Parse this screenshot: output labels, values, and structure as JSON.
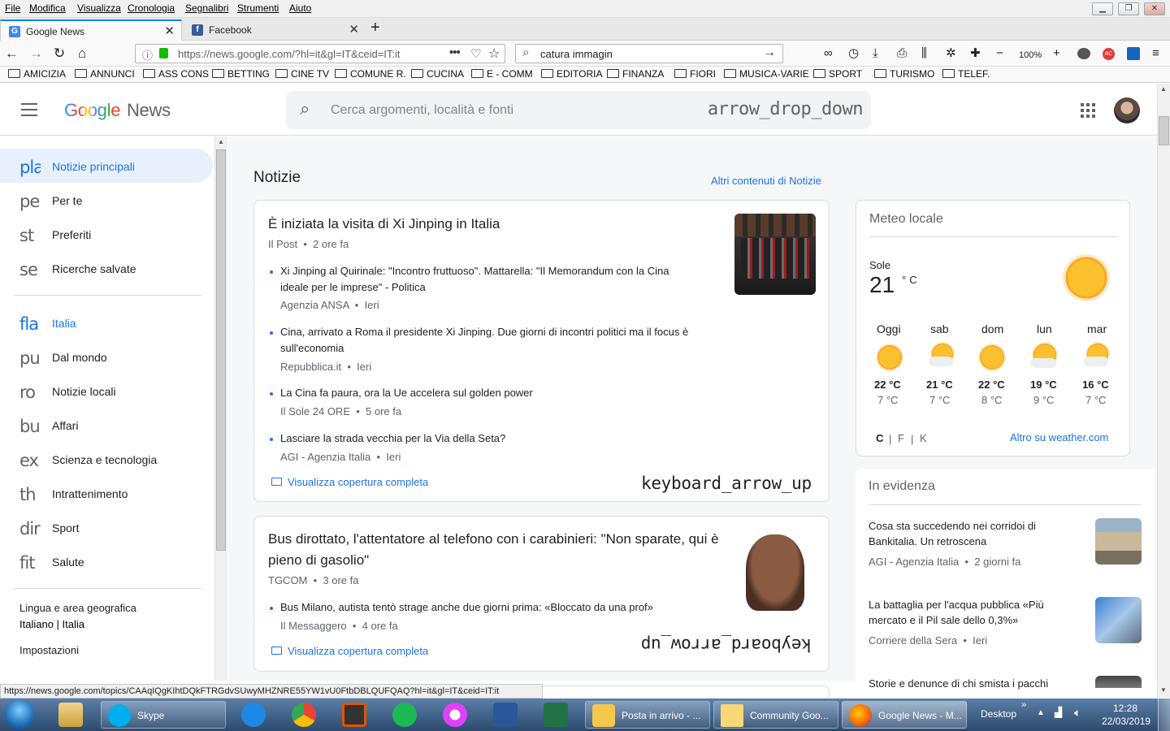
{
  "menubar": {
    "items": [
      "File",
      "Modifica",
      "Visualizza",
      "Cronologia",
      "Segnalibri",
      "Strumenti",
      "Aiuto"
    ]
  },
  "tabs": [
    {
      "title": "Google News",
      "icon": "google-news-icon",
      "active": true
    },
    {
      "title": "Facebook",
      "icon": "facebook-icon",
      "active": false
    }
  ],
  "navbar": {
    "url": "https://news.google.com/?hl=it&gl=IT&ceid=IT:it",
    "search_value": "catura immagin",
    "zoom": "100%"
  },
  "bookmarks": [
    "AMICIZIA",
    "ANNUNCI",
    "ASS CONS",
    "BETTING",
    "CINE TV",
    "COMUNE R.",
    "CUCINA",
    "E - COMM",
    "EDITORIA",
    "FINANZA",
    "FIORI",
    "MUSICA-VARIE",
    "SPORT",
    "TURISMO",
    "TELEF."
  ],
  "header": {
    "logo_google": "Google",
    "logo_news": "News",
    "search_placeholder": "Cerca argomenti, località e fonti",
    "dropdown_glyph": "arrow_drop_down"
  },
  "sidebar": {
    "primary": [
      {
        "icon": "pla",
        "label": "Notizie principali"
      },
      {
        "icon": "pe",
        "label": "Per te"
      },
      {
        "icon": "st",
        "label": "Preferiti"
      },
      {
        "icon": "se",
        "label": "Ricerche salvate"
      }
    ],
    "topics": [
      {
        "icon": "fla",
        "label": "Italia"
      },
      {
        "icon": "pu",
        "label": "Dal mondo"
      },
      {
        "icon": "ro",
        "label": "Notizie locali"
      },
      {
        "icon": "bu",
        "label": "Affari"
      },
      {
        "icon": "ex",
        "label": "Scienza e tecnologia"
      },
      {
        "icon": "th",
        "label": "Intrattenimento"
      },
      {
        "icon": "dir",
        "label": "Sport"
      },
      {
        "icon": "fit",
        "label": "Salute"
      }
    ],
    "lang_title": "Lingua e area geografica",
    "lang_value": "Italiano | Italia",
    "settings": "Impostazioni"
  },
  "main": {
    "section_title": "Notizie",
    "more_link": "Altri contenuti di Notizie",
    "stories": [
      {
        "headline": "È iniziata la visita di Xi Jinping in Italia",
        "source": "Il Post",
        "time": "2 ore fa",
        "subs": [
          {
            "title": "Xi Jinping al Quirinale: \"Incontro fruttuoso\". Mattarella: \"Il Memorandum con la Cina ideale per le imprese\" - Politica",
            "source": "Agenzia ANSA",
            "time": "Ieri"
          },
          {
            "title": "Cina, arrivato a Roma il presidente Xi Jinping. Due giorni di incontri politici ma il focus è sull'economia",
            "source": "Repubblica.it",
            "time": "Ieri"
          },
          {
            "title": "La Cina fa paura, ora la Ue accelera sul golden power",
            "source": "Il Sole 24 ORE",
            "time": "5 ore fa"
          },
          {
            "title": "Lasciare la strada vecchia per la Via della Seta?",
            "source": "AGI - Agenzia Italia",
            "time": "Ieri"
          }
        ],
        "coverage": "Visualizza copertura completa",
        "toggle_glyph": "keyboard_arrow_up"
      },
      {
        "headline": "Bus dirottato, l'attentatore al telefono con i carabinieri: \"Non sparate, qui è pieno di gasolio\"",
        "source": "TGCOM",
        "time": "3 ore fa",
        "subs": [
          {
            "title": "Bus Milano, autista tentò strage anche due giorni prima: «Bloccato da una prof»",
            "source": "Il Messaggero",
            "time": "4 ore fa"
          }
        ],
        "coverage": "Visualizza copertura completa",
        "toggle_glyph": "keyboard_arrow_up"
      }
    ]
  },
  "weather": {
    "title": "Meteo locale",
    "condition": "Sole",
    "temp": "21",
    "unit": "°C",
    "days": [
      {
        "day": "Oggi",
        "hi": "22 °C",
        "lo": "7 °C",
        "icon": "sun-icon"
      },
      {
        "day": "sab",
        "hi": "21 °C",
        "lo": "7 °C",
        "icon": "partly-cloudy-icon"
      },
      {
        "day": "dom",
        "hi": "22 °C",
        "lo": "8 °C",
        "icon": "sun-icon"
      },
      {
        "day": "lun",
        "hi": "19 °C",
        "lo": "9 °C",
        "icon": "partly-cloudy-icon"
      },
      {
        "day": "mar",
        "hi": "16 °C",
        "lo": "7 °C",
        "icon": "partly-cloudy-icon"
      }
    ],
    "units": [
      "C",
      "F",
      "K"
    ],
    "more": "Altro su weather.com"
  },
  "evidenza": {
    "title": "In evidenza",
    "items": [
      {
        "title": "Cosa sta succedendo nei corridoi di Bankitalia. Un retroscena",
        "source": "AGI - Agenzia Italia",
        "time": "2 giorni fa"
      },
      {
        "title": "La battaglia per l'acqua pubblica «Più mercato e il Pil sale dello 0,3%»",
        "source": "Corriere della Sera",
        "time": "Ieri"
      },
      {
        "title": "Storie e denunce di chi smista i pacchi",
        "source": "",
        "time": ""
      }
    ]
  },
  "status_url": "https://news.google.com/topics/CAAqIQgKIhtDQkFTRGdvSUwyMHZNRE55YW1vU0FtbDBLQUFQAQ?hl=it&gl=IT&ceid=IT:it",
  "taskbar": {
    "items": [
      "Skype",
      "Posta in arrivo - ...",
      "Community Goo...",
      "Google News - M..."
    ],
    "desktop": "Desktop",
    "time": "12:28",
    "date": "22/03/2019"
  },
  "colors": {
    "accent": "#1a73e8",
    "google_blue": "#4285f4",
    "google_red": "#ea4335",
    "google_yellow": "#fbbc05",
    "google_green": "#34a853"
  }
}
